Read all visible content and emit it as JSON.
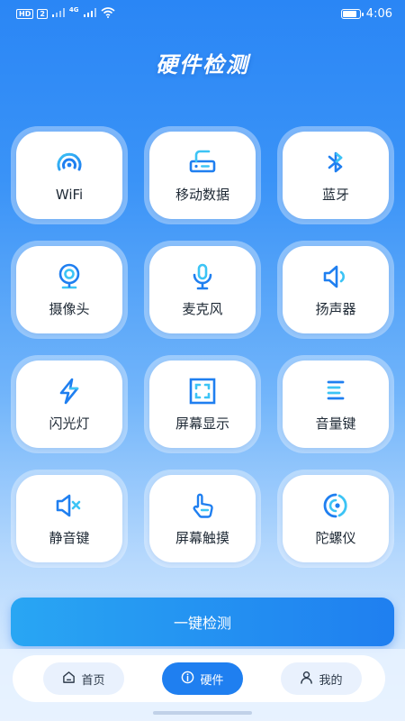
{
  "status_bar": {
    "left_badge_1": "HD",
    "left_badge_2": "2",
    "network": "4G",
    "time": "4:06"
  },
  "page_title": "硬件检测",
  "items": [
    {
      "label": "WiFi",
      "icon": "wifi-icon"
    },
    {
      "label": "移动数据",
      "icon": "router-icon"
    },
    {
      "label": "蓝牙",
      "icon": "bluetooth-icon"
    },
    {
      "label": "摄像头",
      "icon": "camera-icon"
    },
    {
      "label": "麦克风",
      "icon": "microphone-icon"
    },
    {
      "label": "扬声器",
      "icon": "speaker-icon"
    },
    {
      "label": "闪光灯",
      "icon": "flash-icon"
    },
    {
      "label": "屏幕显示",
      "icon": "screen-frame-icon"
    },
    {
      "label": "音量键",
      "icon": "volume-key-icon"
    },
    {
      "label": "静音键",
      "icon": "mute-icon"
    },
    {
      "label": "屏幕触摸",
      "icon": "touch-hand-icon"
    },
    {
      "label": "陀螺仪",
      "icon": "gyroscope-icon"
    }
  ],
  "one_key_button": "一键检测",
  "nav": {
    "home": "首页",
    "hardware": "硬件",
    "mine": "我的"
  },
  "colors": {
    "accent": "#1f7ff0",
    "icon_light": "#3cc4f5"
  }
}
